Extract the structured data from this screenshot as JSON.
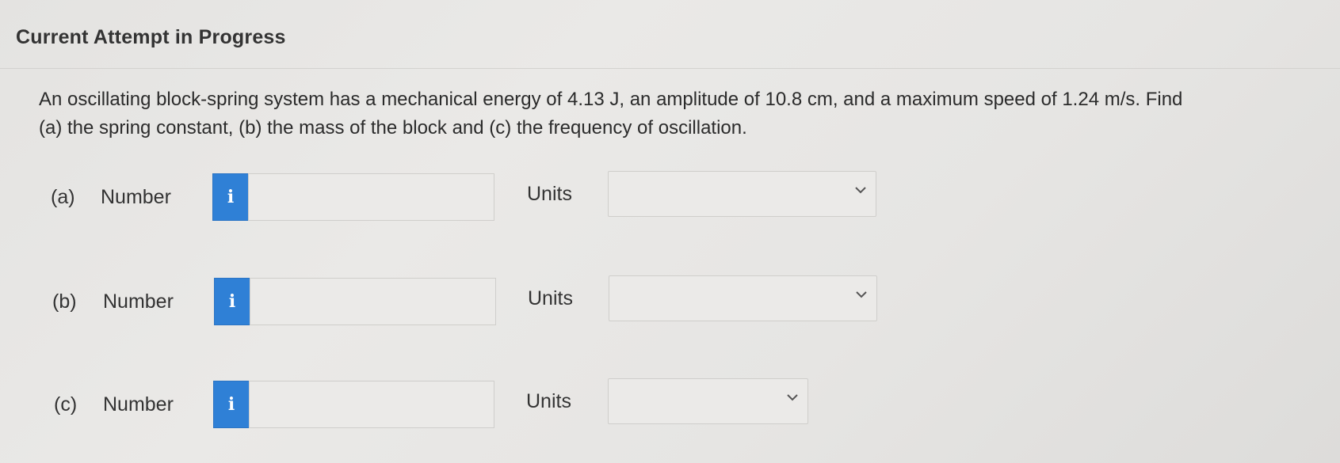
{
  "header": {
    "title": "Current Attempt in Progress"
  },
  "question": {
    "line1": "An oscillating block-spring system has a mechanical energy of 4.13 J, an amplitude of 10.8 cm, and a maximum speed of 1.24 m/s. Find",
    "line2": "(a) the spring constant, (b) the mass of the block and (c) the frequency of oscillation."
  },
  "parts": [
    {
      "label": "(a)",
      "number_label": "Number",
      "info_icon": "i",
      "value": "",
      "units_label": "Units",
      "units_selected": ""
    },
    {
      "label": "(b)",
      "number_label": "Number",
      "info_icon": "i",
      "value": "",
      "units_label": "Units",
      "units_selected": ""
    },
    {
      "label": "(c)",
      "number_label": "Number",
      "info_icon": "i",
      "value": "",
      "units_label": "Units",
      "units_selected": ""
    }
  ],
  "colors": {
    "info_button": "#2f80d6",
    "background": "#e6e5e3",
    "input_border": "#cfcecb"
  },
  "icons": {
    "info": "info-icon",
    "dropdown": "chevron-down-icon"
  }
}
